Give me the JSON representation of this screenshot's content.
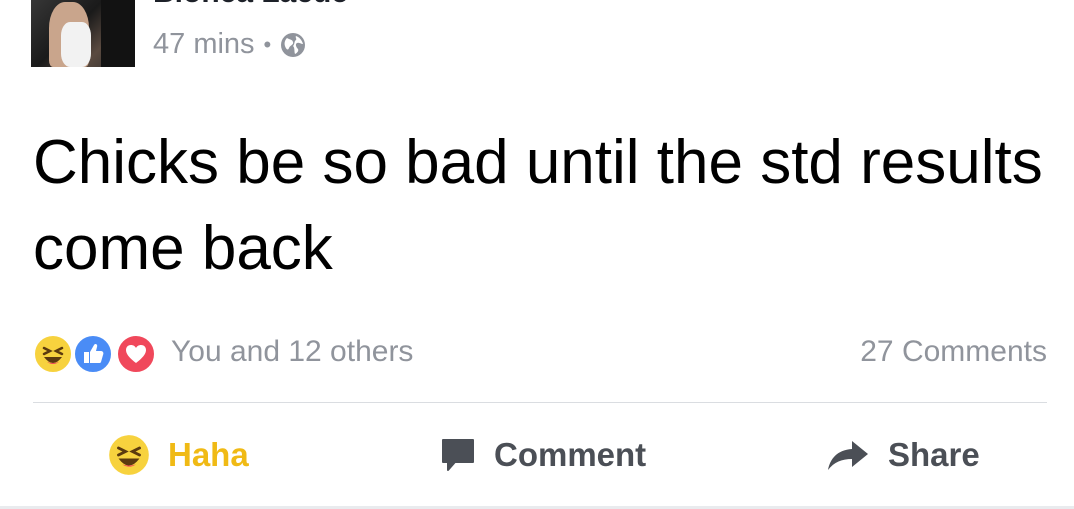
{
  "post": {
    "author": "Bionca Lacue",
    "timestamp": "47 mins",
    "separator": "•",
    "privacy_icon": "globe-icon",
    "text": "Chicks be so bad until the std results come back"
  },
  "reactions": {
    "icons": [
      "haha-reaction-icon",
      "like-reaction-icon",
      "love-reaction-icon"
    ],
    "summary": "You and 12 others",
    "comments_count": "27 Comments"
  },
  "actions": {
    "haha_label": "Haha",
    "comment_label": "Comment",
    "share_label": "Share"
  },
  "colors": {
    "haha_active": "#f0ba15",
    "secondary_text": "#90949c",
    "action_text": "#4b4f56",
    "like_blue": "#4a8cf6",
    "love_red": "#f0485b",
    "haha_yellow": "#f7d23e"
  }
}
